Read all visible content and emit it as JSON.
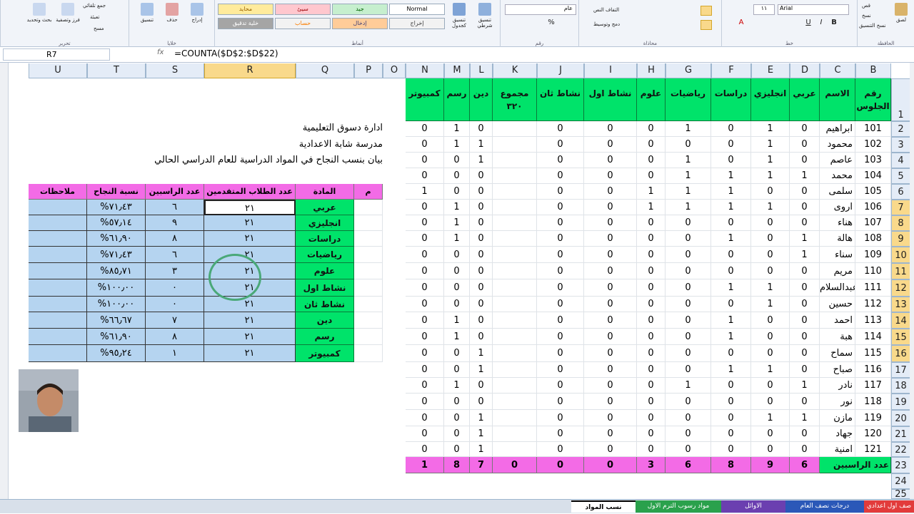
{
  "ribbon": {
    "groups": [
      {
        "title": "الحافظة",
        "buttons": [
          "لصق",
          "قص",
          "نسخ",
          "نسخ التنسيق"
        ]
      },
      {
        "title": "خط",
        "buttons": [
          "Arial",
          "١١",
          "غامق",
          "مائل",
          "تسطير"
        ]
      },
      {
        "title": "محاذاة",
        "buttons": [
          "التفاف النص",
          "دمج وتوسيط"
        ]
      },
      {
        "title": "رقم",
        "buttons": [
          "عام",
          "%"
        ]
      },
      {
        "title": "أنماط",
        "buttons": [
          "تنسيق شرطي",
          "تنسيق كجدول"
        ]
      },
      {
        "title": "خلايا",
        "buttons": [
          "إدراج",
          "حذف",
          "تنسيق"
        ]
      },
      {
        "title": "تحرير",
        "buttons": [
          "جمع تلقائي",
          "تعبئة",
          "مسح",
          "فرز وتصفية",
          "بحث وتحديد"
        ]
      }
    ],
    "styles": [
      {
        "label": "Normal",
        "bg": "#ffffff",
        "fg": "#000000"
      },
      {
        "label": "جيد",
        "bg": "#c6efce",
        "fg": "#006100"
      },
      {
        "label": "سيئ",
        "bg": "#ffc7ce",
        "fg": "#9c0006"
      },
      {
        "label": "محايد",
        "bg": "#ffeb9c",
        "fg": "#9c6500"
      },
      {
        "label": "إخراج",
        "bg": "#f2f2f2",
        "fg": "#3f3f3f"
      },
      {
        "label": "إدخال",
        "bg": "#ffcc99",
        "fg": "#3f3f76"
      },
      {
        "label": "حساب",
        "bg": "#f2f2f2",
        "fg": "#fa7d00"
      },
      {
        "label": "خلية تدقيق",
        "bg": "#a5a5a5",
        "fg": "#ffffff"
      }
    ]
  },
  "formula_bar": {
    "name_box": "R7",
    "formula": "=COUNTA($D$2:$D$22)"
  },
  "columns": [
    "B",
    "C",
    "D",
    "E",
    "F",
    "G",
    "H",
    "I",
    "J",
    "K",
    "L",
    "M",
    "N",
    "O",
    "P",
    "Q",
    "R",
    "S",
    "T",
    "U"
  ],
  "rows": [
    "1",
    "2",
    "3",
    "4",
    "5",
    "6",
    "7",
    "8",
    "9",
    "10",
    "11",
    "12",
    "13",
    "14",
    "15",
    "16",
    "17",
    "18",
    "19",
    "20",
    "21",
    "22",
    "23",
    "24",
    "25"
  ],
  "grades_table": {
    "headers": [
      "رقم الجلوس",
      "الاسم",
      "عربي",
      "انجليزي",
      "دراسات",
      "رياضيات",
      "علوم",
      "نشاط اول",
      "نشاط ثان",
      "مجموع ٣٢٠",
      "دين",
      "رسم",
      "كمبيوتر"
    ],
    "rows": [
      [
        "101",
        "ابراهيم",
        "0",
        "1",
        "0",
        "1",
        "0",
        "0",
        "0",
        "",
        "0",
        "1",
        "0"
      ],
      [
        "102",
        "محمود",
        "0",
        "1",
        "0",
        "0",
        "0",
        "0",
        "0",
        "",
        "1",
        "1",
        "0"
      ],
      [
        "103",
        "عاصم",
        "0",
        "1",
        "0",
        "1",
        "0",
        "0",
        "0",
        "",
        "1",
        "0",
        "0"
      ],
      [
        "104",
        "محمد",
        "1",
        "1",
        "1",
        "1",
        "0",
        "0",
        "0",
        "",
        "0",
        "0",
        "0"
      ],
      [
        "105",
        "سلمى",
        "0",
        "0",
        "1",
        "1",
        "1",
        "0",
        "0",
        "",
        "0",
        "0",
        "1"
      ],
      [
        "106",
        "اروى",
        "0",
        "1",
        "1",
        "1",
        "1",
        "0",
        "0",
        "",
        "0",
        "1",
        "0"
      ],
      [
        "107",
        "هناء",
        "0",
        "0",
        "0",
        "0",
        "0",
        "0",
        "0",
        "",
        "0",
        "1",
        "0"
      ],
      [
        "108",
        "هالة",
        "1",
        "0",
        "1",
        "0",
        "0",
        "0",
        "0",
        "",
        "0",
        "1",
        "0"
      ],
      [
        "109",
        "سناء",
        "1",
        "0",
        "0",
        "0",
        "0",
        "0",
        "0",
        "",
        "0",
        "0",
        "0"
      ],
      [
        "110",
        "مريم",
        "0",
        "0",
        "0",
        "0",
        "0",
        "0",
        "0",
        "",
        "0",
        "0",
        "0"
      ],
      [
        "111",
        "عبدالسلام",
        "0",
        "1",
        "1",
        "0",
        "0",
        "0",
        "0",
        "",
        "0",
        "0",
        "0"
      ],
      [
        "112",
        "حسين",
        "0",
        "1",
        "0",
        "0",
        "0",
        "0",
        "0",
        "",
        "0",
        "0",
        "0"
      ],
      [
        "113",
        "احمد",
        "0",
        "0",
        "1",
        "0",
        "0",
        "0",
        "0",
        "",
        "0",
        "1",
        "0"
      ],
      [
        "114",
        "هبة",
        "0",
        "0",
        "1",
        "0",
        "0",
        "0",
        "0",
        "",
        "0",
        "1",
        "0"
      ],
      [
        "115",
        "سماح",
        "0",
        "0",
        "0",
        "0",
        "0",
        "0",
        "0",
        "",
        "1",
        "0",
        "0"
      ],
      [
        "116",
        "صباح",
        "0",
        "1",
        "1",
        "0",
        "0",
        "0",
        "0",
        "",
        "1",
        "0",
        "0"
      ],
      [
        "117",
        "نادر",
        "1",
        "0",
        "0",
        "1",
        "0",
        "0",
        "0",
        "",
        "0",
        "1",
        "0"
      ],
      [
        "118",
        "نور",
        "0",
        "0",
        "0",
        "0",
        "0",
        "0",
        "0",
        "",
        "0",
        "0",
        "0"
      ],
      [
        "119",
        "مازن",
        "1",
        "1",
        "0",
        "0",
        "0",
        "0",
        "0",
        "",
        "1",
        "0",
        "0"
      ],
      [
        "120",
        "جهاد",
        "0",
        "0",
        "0",
        "0",
        "0",
        "0",
        "0",
        "",
        "1",
        "0",
        "0"
      ],
      [
        "121",
        "امنية",
        "0",
        "0",
        "0",
        "0",
        "0",
        "0",
        "0",
        "",
        "1",
        "0",
        "0"
      ]
    ],
    "totals_label": "عدد الراسبين",
    "totals": [
      "6",
      "9",
      "8",
      "6",
      "3",
      "0",
      "0",
      "0",
      "7",
      "8",
      "1"
    ]
  },
  "titles": [
    "ادارة دسوق التعليمية",
    "مدرسة شابة الاعدادية",
    "بيان بنسب النجاح في المواد الدراسية للعام الدراسي الحالي"
  ],
  "summary_table": {
    "headers": [
      "م",
      "المادة",
      "عدد الطلاب المتقدمين",
      "عدد الراسبين",
      "نسبة النجاح",
      "ملاحظات"
    ],
    "rows": [
      [
        "",
        "عربي",
        "٢١",
        "٦",
        "%٧١٫٤٣",
        ""
      ],
      [
        "",
        "انجليزي",
        "٢١",
        "٩",
        "%٥٧٫١٤",
        ""
      ],
      [
        "",
        "دراسات",
        "٢١",
        "٨",
        "%٦١٫٩٠",
        ""
      ],
      [
        "",
        "رياضيات",
        "٢١",
        "٦",
        "%٧١٫٤٣",
        ""
      ],
      [
        "",
        "علوم",
        "٢١",
        "٣",
        "%٨٥٫٧١",
        ""
      ],
      [
        "",
        "نشاط اول",
        "٢١",
        "٠",
        "%١٠٠٫٠٠",
        ""
      ],
      [
        "",
        "نشاط ثان",
        "٢١",
        "٠",
        "%١٠٠٫٠٠",
        ""
      ],
      [
        "",
        "دين",
        "٢١",
        "٧",
        "%٦٦٫٦٧",
        ""
      ],
      [
        "",
        "رسم",
        "٢١",
        "٨",
        "%٦١٫٩٠",
        ""
      ],
      [
        "",
        "كمبيوتر",
        "٢١",
        "١",
        "%٩٥٫٢٤",
        ""
      ]
    ]
  },
  "sheet_tabs": [
    {
      "label": "صف اول اعدادي",
      "color": "#e23b3b",
      "active": false
    },
    {
      "label": "درجات نصف العام",
      "color": "#2b58b8",
      "active": false
    },
    {
      "label": "الاوائل",
      "color": "#6b3fb0",
      "active": false
    },
    {
      "label": "مواد رسوب الترم الاول",
      "color": "#2aa14c",
      "active": false
    },
    {
      "label": "نسب المواد",
      "color": "#ffffff",
      "active": true
    }
  ]
}
